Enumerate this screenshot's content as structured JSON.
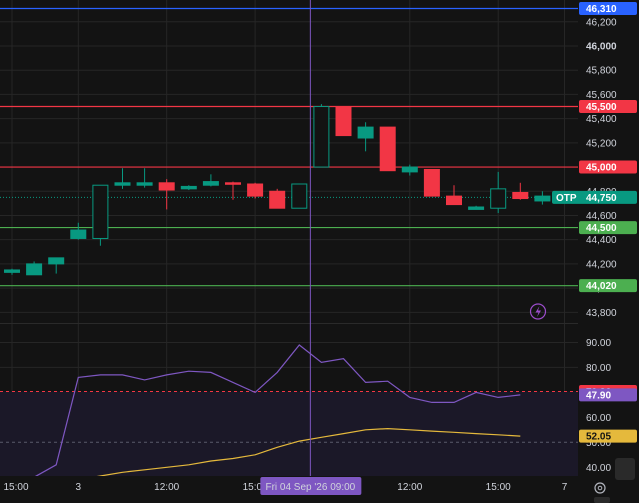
{
  "chart_data": [
    {
      "type": "candlestick",
      "ylim": [
        43720,
        46380
      ],
      "price_ticks": [
        43800,
        44000,
        44200,
        44400,
        44600,
        44800,
        45000,
        45200,
        45400,
        45600,
        45800,
        46000,
        46200
      ],
      "bold_ticks": [
        46000
      ],
      "x_ticks": [
        {
          "idx": 0,
          "label": "15:00"
        },
        {
          "idx": 3,
          "label": "3"
        },
        {
          "idx": 7,
          "label": "12:00"
        },
        {
          "idx": 11,
          "label": "15:00"
        },
        {
          "idx": 18,
          "label": "12:00"
        },
        {
          "idx": 22,
          "label": "15:00"
        },
        {
          "idx": 25,
          "label": "7"
        }
      ],
      "candles": [
        {
          "o": 44130,
          "h": 44160,
          "l": 44110,
          "c": 44150
        },
        {
          "o": 44110,
          "h": 44220,
          "l": 44110,
          "c": 44200
        },
        {
          "o": 44200,
          "h": 44250,
          "l": 44120,
          "c": 44250
        },
        {
          "o": 44410,
          "h": 44540,
          "l": 44400,
          "c": 44480
        },
        {
          "o": 44410,
          "h": 44850,
          "l": 44350,
          "c": 44850
        },
        {
          "o": 44850,
          "h": 44990,
          "l": 44820,
          "c": 44870
        },
        {
          "o": 44850,
          "h": 44990,
          "l": 44830,
          "c": 44870
        },
        {
          "o": 44870,
          "h": 44900,
          "l": 44650,
          "c": 44810
        },
        {
          "o": 44820,
          "h": 44850,
          "l": 44810,
          "c": 44840
        },
        {
          "o": 44850,
          "h": 44940,
          "l": 44840,
          "c": 44880
        },
        {
          "o": 44870,
          "h": 44880,
          "l": 44730,
          "c": 44860
        },
        {
          "o": 44860,
          "h": 44870,
          "l": 44740,
          "c": 44760
        },
        {
          "o": 44800,
          "h": 44820,
          "l": 44660,
          "c": 44660
        },
        {
          "o": 44660,
          "h": 44860,
          "l": 44660,
          "c": 44860
        },
        {
          "o": 45000,
          "h": 45520,
          "l": 45000,
          "c": 45500
        },
        {
          "o": 45500,
          "h": 45500,
          "l": 45260,
          "c": 45260
        },
        {
          "o": 45240,
          "h": 45370,
          "l": 45130,
          "c": 45330
        },
        {
          "o": 45330,
          "h": 45330,
          "l": 44970,
          "c": 44970
        },
        {
          "o": 44960,
          "h": 45020,
          "l": 44930,
          "c": 45000
        },
        {
          "o": 44980,
          "h": 44980,
          "l": 44760,
          "c": 44760
        },
        {
          "o": 44760,
          "h": 44850,
          "l": 44690,
          "c": 44690
        },
        {
          "o": 44650,
          "h": 44680,
          "l": 44650,
          "c": 44670
        },
        {
          "o": 44660,
          "h": 44960,
          "l": 44620,
          "c": 44820
        },
        {
          "o": 44790,
          "h": 44870,
          "l": 44730,
          "c": 44740
        },
        {
          "o": 44720,
          "h": 44800,
          "l": 44690,
          "c": 44760
        }
      ],
      "hlines": [
        {
          "value": 46310,
          "label": "46,310",
          "color": "#2962ff"
        },
        {
          "value": 45500,
          "label": "45,500",
          "color": "#f23645"
        },
        {
          "value": 45000,
          "label": "45,000",
          "color": "#f23645"
        },
        {
          "value": 44500,
          "label": "44,500",
          "color": "#4caf50"
        },
        {
          "value": 44020,
          "label": "44,020",
          "color": "#4caf50"
        }
      ],
      "current": {
        "value": 44750,
        "label": "44,750",
        "symbol": "OTP",
        "color": "#089981"
      }
    },
    {
      "type": "line",
      "ylim": [
        36.5,
        97
      ],
      "y_ticks": [
        40,
        50,
        60,
        70,
        80,
        90
      ],
      "overbought": {
        "value": 70.36,
        "label": "70.36",
        "color": "#f23645"
      },
      "midline": 50,
      "series": [
        {
          "color": "#7e57c2",
          "label": "47.90",
          "values": [
            31,
            36,
            41,
            76,
            77,
            77,
            75,
            77,
            78.5,
            78,
            74,
            70,
            78,
            89,
            82,
            83.5,
            74,
            74.5,
            68,
            66,
            66,
            70,
            68,
            69
          ]
        },
        {
          "color": "#e5b93c",
          "label": "52.05",
          "values": [
            null,
            null,
            null,
            35,
            36.5,
            38,
            39,
            40,
            41,
            42.5,
            43.5,
            45,
            48,
            50.5,
            52,
            53.5,
            55,
            55.5,
            55,
            54.5,
            54,
            53.5,
            53,
            52.5
          ]
        }
      ]
    }
  ],
  "crosshair": {
    "index": 13.5,
    "label": "Fri 04 Sep '26   09:00",
    "color": "#7e57c2"
  },
  "lightning_icon_color": "#9c4dcc",
  "settings_icon": "gear-icon"
}
